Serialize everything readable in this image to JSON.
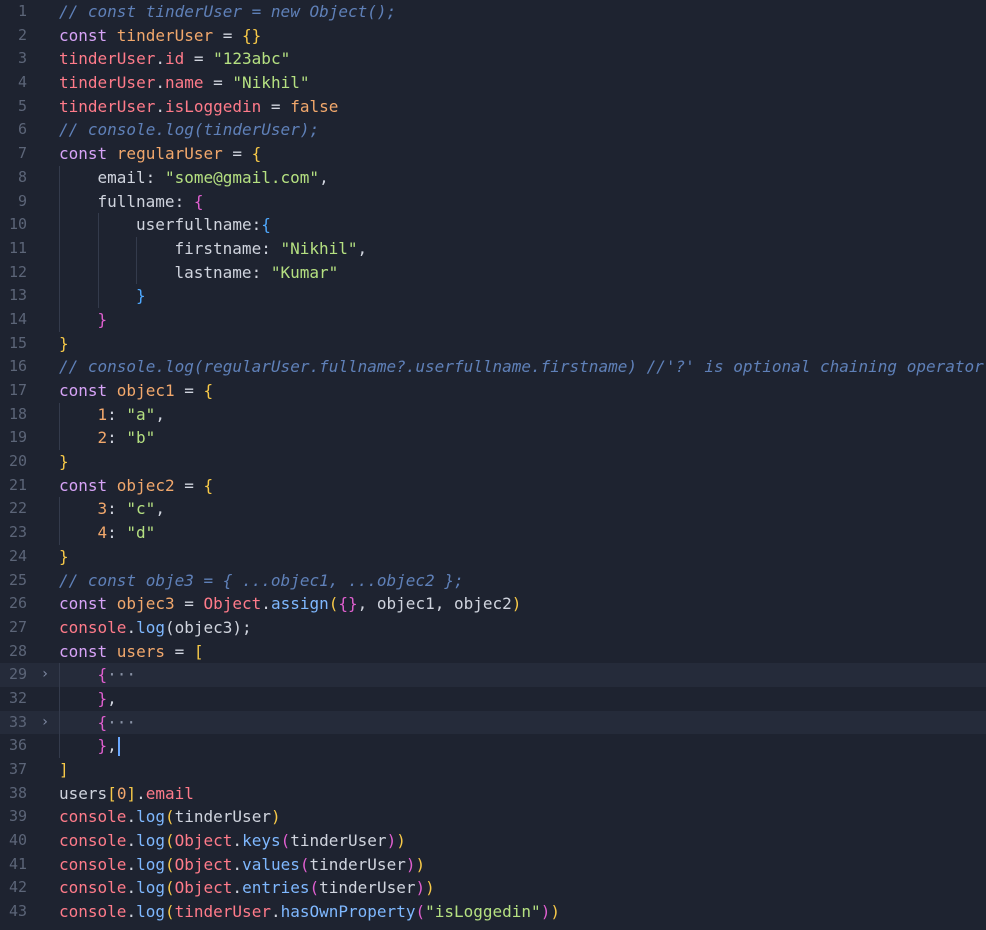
{
  "editor": {
    "lines": [
      {
        "num": "1",
        "indent": 0,
        "tokens": [
          {
            "t": "comment",
            "v": "// const tinderUser = new Object();"
          }
        ]
      },
      {
        "num": "2",
        "indent": 0,
        "tokens": [
          {
            "t": "keyword",
            "v": "const "
          },
          {
            "t": "var",
            "v": "tinderUser"
          },
          {
            "t": "op",
            "v": " = "
          },
          {
            "t": "brace",
            "v": "{}"
          }
        ]
      },
      {
        "num": "3",
        "indent": 0,
        "tokens": [
          {
            "t": "prop",
            "v": "tinderUser"
          },
          {
            "t": "op",
            "v": "."
          },
          {
            "t": "prop",
            "v": "id"
          },
          {
            "t": "op",
            "v": " = "
          },
          {
            "t": "string",
            "v": "\"123abc\""
          }
        ]
      },
      {
        "num": "4",
        "indent": 0,
        "tokens": [
          {
            "t": "prop",
            "v": "tinderUser"
          },
          {
            "t": "op",
            "v": "."
          },
          {
            "t": "prop",
            "v": "name"
          },
          {
            "t": "op",
            "v": " = "
          },
          {
            "t": "string",
            "v": "\"Nikhil\""
          }
        ]
      },
      {
        "num": "5",
        "indent": 0,
        "tokens": [
          {
            "t": "prop",
            "v": "tinderUser"
          },
          {
            "t": "op",
            "v": "."
          },
          {
            "t": "prop",
            "v": "isLoggedin"
          },
          {
            "t": "op",
            "v": " = "
          },
          {
            "t": "bool",
            "v": "false"
          }
        ]
      },
      {
        "num": "6",
        "indent": 0,
        "tokens": [
          {
            "t": "comment",
            "v": "// console.log(tinderUser);"
          }
        ]
      },
      {
        "num": "7",
        "indent": 0,
        "tokens": [
          {
            "t": "keyword",
            "v": "const "
          },
          {
            "t": "var",
            "v": "regularUser"
          },
          {
            "t": "op",
            "v": " = "
          },
          {
            "t": "brace",
            "v": "{"
          }
        ]
      },
      {
        "num": "8",
        "indent": 1,
        "tokens": [
          {
            "t": "plain",
            "v": "email: "
          },
          {
            "t": "string",
            "v": "\"some@gmail.com\""
          },
          {
            "t": "plain",
            "v": ","
          }
        ]
      },
      {
        "num": "9",
        "indent": 1,
        "tokens": [
          {
            "t": "plain",
            "v": "fullname: "
          },
          {
            "t": "brace2",
            "v": "{"
          }
        ]
      },
      {
        "num": "10",
        "indent": 2,
        "tokens": [
          {
            "t": "plain",
            "v": "userfullname:"
          },
          {
            "t": "brace3",
            "v": "{"
          }
        ]
      },
      {
        "num": "11",
        "indent": 3,
        "tokens": [
          {
            "t": "plain",
            "v": "firstname: "
          },
          {
            "t": "string",
            "v": "\"Nikhil\""
          },
          {
            "t": "plain",
            "v": ","
          }
        ]
      },
      {
        "num": "12",
        "indent": 3,
        "tokens": [
          {
            "t": "plain",
            "v": "lastname: "
          },
          {
            "t": "string",
            "v": "\"Kumar\""
          }
        ]
      },
      {
        "num": "13",
        "indent": 2,
        "tokens": [
          {
            "t": "brace3",
            "v": "}"
          }
        ]
      },
      {
        "num": "14",
        "indent": 1,
        "tokens": [
          {
            "t": "brace2",
            "v": "}"
          }
        ]
      },
      {
        "num": "15",
        "indent": 0,
        "tokens": [
          {
            "t": "brace",
            "v": "}"
          }
        ]
      },
      {
        "num": "16",
        "indent": 0,
        "tokens": [
          {
            "t": "comment",
            "v": "// console.log(regularUser.fullname?.userfullname.firstname) //'?' is optional chaining operator"
          }
        ]
      },
      {
        "num": "17",
        "indent": 0,
        "tokens": [
          {
            "t": "keyword",
            "v": "const "
          },
          {
            "t": "var",
            "v": "objec1"
          },
          {
            "t": "op",
            "v": " = "
          },
          {
            "t": "brace",
            "v": "{"
          }
        ]
      },
      {
        "num": "18",
        "indent": 1,
        "tokens": [
          {
            "t": "number",
            "v": "1"
          },
          {
            "t": "plain",
            "v": ": "
          },
          {
            "t": "string",
            "v": "\"a\""
          },
          {
            "t": "plain",
            "v": ","
          }
        ]
      },
      {
        "num": "19",
        "indent": 1,
        "tokens": [
          {
            "t": "number",
            "v": "2"
          },
          {
            "t": "plain",
            "v": ": "
          },
          {
            "t": "string",
            "v": "\"b\""
          }
        ]
      },
      {
        "num": "20",
        "indent": 0,
        "tokens": [
          {
            "t": "brace",
            "v": "}"
          }
        ]
      },
      {
        "num": "21",
        "indent": 0,
        "tokens": [
          {
            "t": "keyword",
            "v": "const "
          },
          {
            "t": "var",
            "v": "objec2"
          },
          {
            "t": "op",
            "v": " = "
          },
          {
            "t": "brace",
            "v": "{"
          }
        ]
      },
      {
        "num": "22",
        "indent": 1,
        "tokens": [
          {
            "t": "number",
            "v": "3"
          },
          {
            "t": "plain",
            "v": ": "
          },
          {
            "t": "string",
            "v": "\"c\""
          },
          {
            "t": "plain",
            "v": ","
          }
        ]
      },
      {
        "num": "23",
        "indent": 1,
        "tokens": [
          {
            "t": "number",
            "v": "4"
          },
          {
            "t": "plain",
            "v": ": "
          },
          {
            "t": "string",
            "v": "\"d\""
          }
        ]
      },
      {
        "num": "24",
        "indent": 0,
        "tokens": [
          {
            "t": "brace",
            "v": "}"
          }
        ]
      },
      {
        "num": "25",
        "indent": 0,
        "tokens": [
          {
            "t": "comment",
            "v": "// const obje3 = { ...objec1, ...objec2 };"
          }
        ]
      },
      {
        "num": "26",
        "indent": 0,
        "tokens": [
          {
            "t": "keyword",
            "v": "const "
          },
          {
            "t": "var",
            "v": "objec3"
          },
          {
            "t": "op",
            "v": " = "
          },
          {
            "t": "class",
            "v": "Object"
          },
          {
            "t": "op",
            "v": "."
          },
          {
            "t": "method",
            "v": "assign"
          },
          {
            "t": "brace",
            "v": "("
          },
          {
            "t": "brace2",
            "v": "{}"
          },
          {
            "t": "plain",
            "v": ", objec1, objec2"
          },
          {
            "t": "brace",
            "v": ")"
          }
        ]
      },
      {
        "num": "27",
        "indent": 0,
        "tokens": [
          {
            "t": "prop",
            "v": "console"
          },
          {
            "t": "op",
            "v": "."
          },
          {
            "t": "method",
            "v": "log"
          },
          {
            "t": "plain",
            "v": "(objec3);"
          }
        ]
      },
      {
        "num": "28",
        "indent": 0,
        "tokens": [
          {
            "t": "keyword",
            "v": "const "
          },
          {
            "t": "var",
            "v": "users"
          },
          {
            "t": "op",
            "v": " = "
          },
          {
            "t": "brace",
            "v": "["
          }
        ]
      },
      {
        "num": "29",
        "indent": 1,
        "fold": true,
        "highlight": true,
        "tokens": [
          {
            "t": "brace2",
            "v": "{"
          },
          {
            "t": "ellipsis",
            "v": "···"
          }
        ]
      },
      {
        "num": "32",
        "indent": 1,
        "tokens": [
          {
            "t": "brace2",
            "v": "}"
          },
          {
            "t": "plain",
            "v": ","
          }
        ]
      },
      {
        "num": "33",
        "indent": 1,
        "fold": true,
        "highlight": true,
        "tokens": [
          {
            "t": "brace2",
            "v": "{"
          },
          {
            "t": "ellipsis",
            "v": "···"
          }
        ]
      },
      {
        "num": "36",
        "indent": 1,
        "cursor": true,
        "tokens": [
          {
            "t": "brace2",
            "v": "}"
          },
          {
            "t": "plain",
            "v": ","
          }
        ]
      },
      {
        "num": "37",
        "indent": 0,
        "tokens": [
          {
            "t": "brace",
            "v": "]"
          }
        ]
      },
      {
        "num": "38",
        "indent": 0,
        "tokens": [
          {
            "t": "plain",
            "v": "users"
          },
          {
            "t": "brace",
            "v": "["
          },
          {
            "t": "number",
            "v": "0"
          },
          {
            "t": "brace",
            "v": "]"
          },
          {
            "t": "op",
            "v": "."
          },
          {
            "t": "prop",
            "v": "email"
          }
        ]
      },
      {
        "num": "39",
        "indent": 0,
        "tokens": [
          {
            "t": "prop",
            "v": "console"
          },
          {
            "t": "op",
            "v": "."
          },
          {
            "t": "method",
            "v": "log"
          },
          {
            "t": "brace",
            "v": "("
          },
          {
            "t": "plain",
            "v": "tinderUser"
          },
          {
            "t": "brace",
            "v": ")"
          }
        ]
      },
      {
        "num": "40",
        "indent": 0,
        "tokens": [
          {
            "t": "prop",
            "v": "console"
          },
          {
            "t": "op",
            "v": "."
          },
          {
            "t": "method",
            "v": "log"
          },
          {
            "t": "brace",
            "v": "("
          },
          {
            "t": "class",
            "v": "Object"
          },
          {
            "t": "op",
            "v": "."
          },
          {
            "t": "method",
            "v": "keys"
          },
          {
            "t": "brace2",
            "v": "("
          },
          {
            "t": "plain",
            "v": "tinderUser"
          },
          {
            "t": "brace2",
            "v": ")"
          },
          {
            "t": "brace",
            "v": ")"
          }
        ]
      },
      {
        "num": "41",
        "indent": 0,
        "tokens": [
          {
            "t": "prop",
            "v": "console"
          },
          {
            "t": "op",
            "v": "."
          },
          {
            "t": "method",
            "v": "log"
          },
          {
            "t": "brace",
            "v": "("
          },
          {
            "t": "class",
            "v": "Object"
          },
          {
            "t": "op",
            "v": "."
          },
          {
            "t": "method",
            "v": "values"
          },
          {
            "t": "brace2",
            "v": "("
          },
          {
            "t": "plain",
            "v": "tinderUser"
          },
          {
            "t": "brace2",
            "v": ")"
          },
          {
            "t": "brace",
            "v": ")"
          }
        ]
      },
      {
        "num": "42",
        "indent": 0,
        "tokens": [
          {
            "t": "prop",
            "v": "console"
          },
          {
            "t": "op",
            "v": "."
          },
          {
            "t": "method",
            "v": "log"
          },
          {
            "t": "brace",
            "v": "("
          },
          {
            "t": "class",
            "v": "Object"
          },
          {
            "t": "op",
            "v": "."
          },
          {
            "t": "method",
            "v": "entries"
          },
          {
            "t": "brace2",
            "v": "("
          },
          {
            "t": "plain",
            "v": "tinderUser"
          },
          {
            "t": "brace2",
            "v": ")"
          },
          {
            "t": "brace",
            "v": ")"
          }
        ]
      },
      {
        "num": "43",
        "indent": 0,
        "tokens": [
          {
            "t": "prop",
            "v": "console"
          },
          {
            "t": "op",
            "v": "."
          },
          {
            "t": "method",
            "v": "log"
          },
          {
            "t": "brace",
            "v": "("
          },
          {
            "t": "prop",
            "v": "tinderUser"
          },
          {
            "t": "op",
            "v": "."
          },
          {
            "t": "method",
            "v": "hasOwnProperty"
          },
          {
            "t": "brace2",
            "v": "("
          },
          {
            "t": "string",
            "v": "\"isLoggedin\""
          },
          {
            "t": "brace2",
            "v": ")"
          },
          {
            "t": "brace",
            "v": ")"
          }
        ]
      }
    ],
    "fold_icon": "chevron-right-icon"
  }
}
